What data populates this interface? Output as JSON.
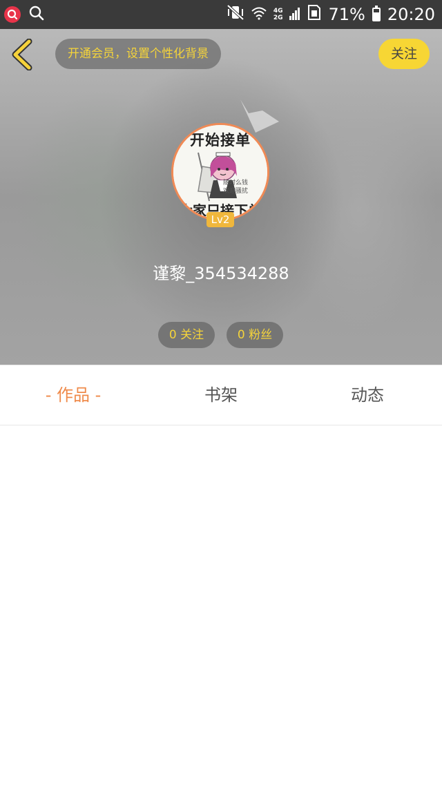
{
  "status_bar": {
    "left_icons": [
      "app-badge-icon",
      "search-icon"
    ],
    "right_icons": [
      "vibrate-mute-icon",
      "wifi-icon",
      "signal-icon",
      "sim-icon",
      "battery-icon"
    ],
    "network_top": "4G",
    "network_bottom": "2G",
    "battery": "71%",
    "battery_level": 0.71,
    "time": "20:20"
  },
  "header": {
    "back_icon": "chevron-left-icon",
    "vip_banner": "开通会员，设置个性化背景",
    "follow_label": "关注",
    "avatar": {
      "image_text_top": "开始接单",
      "image_text_bottom": "大家只接下单",
      "image_note_line1": "随时么钱",
      "image_note_line2": "欢迎骚扰"
    },
    "level_badge": "Lv2",
    "username": "谨黎_354534288",
    "stats": {
      "following": "0 关注",
      "fans": "0 粉丝"
    }
  },
  "tabs": {
    "works": "作品",
    "works_dash": "-",
    "shelf": "书架",
    "feed": "动态"
  },
  "colors": {
    "accent_orange": "#ef8a4a",
    "accent_yellow": "#f7d634",
    "pill_text_yellow": "#f5d43a",
    "status_bar": "#3a3a3a"
  }
}
